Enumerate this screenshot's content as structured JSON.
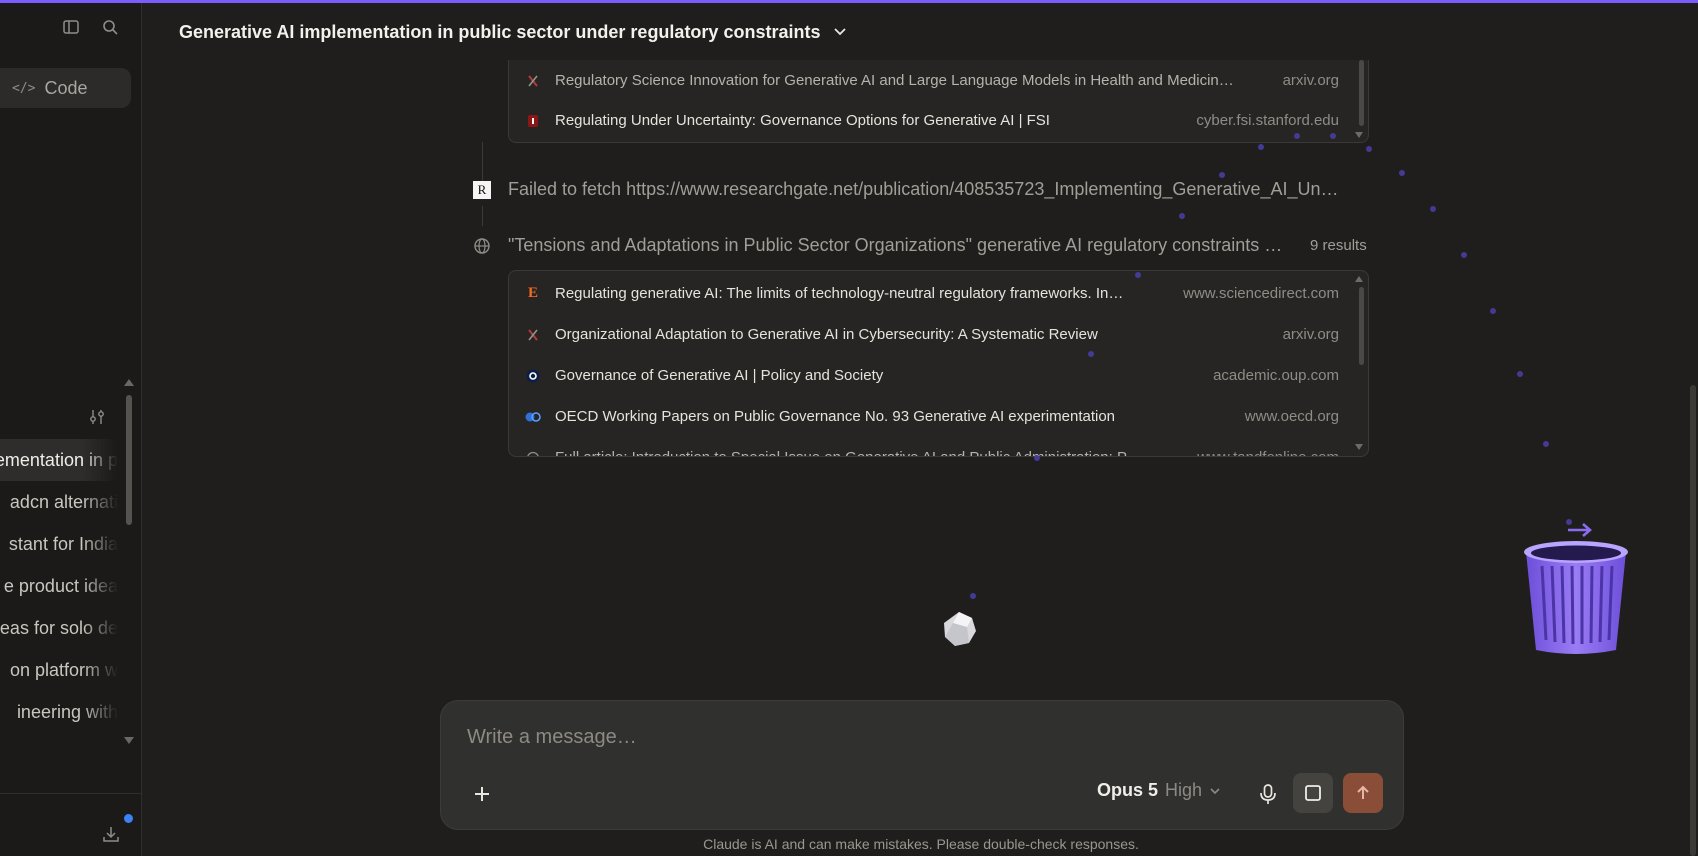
{
  "sidebar": {
    "code_label": "Code",
    "chats": [
      {
        "label": "ementation in p"
      },
      {
        "label": "adcn alternati"
      },
      {
        "label": "stant for India"
      },
      {
        "label": "e product idea"
      },
      {
        "label": "eas for solo de"
      },
      {
        "label": "on platform w"
      },
      {
        "label": "ineering with"
      }
    ]
  },
  "header": {
    "title": "Generative AI implementation in public sector under regulatory constraints"
  },
  "results_top": [
    {
      "title": "Regulatory Science Innovation for Generative AI and Large Language Models in Health and Medicin…",
      "domain": "arxiv.org",
      "favicon": "arxiv-icon"
    },
    {
      "title": "Regulating Under Uncertainty: Governance Options for Generative AI | FSI",
      "domain": "cyber.fsi.stanford.edu",
      "favicon": "stanford-icon"
    }
  ],
  "fetch_step": {
    "text": "Failed to fetch https://www.researchgate.net/publication/408535723_Implementing_Generative_AI_Un…",
    "icon_label": "R"
  },
  "search_step": {
    "query": "\"Tensions and Adaptations in Public Sector Organizations\" generative AI regulatory constraints …",
    "count": "9 results"
  },
  "results_bottom": [
    {
      "title": "Regulating generative AI: The limits of technology-neutral regulatory frameworks. In…",
      "domain": "www.sciencedirect.com",
      "favicon": "elsevier-icon",
      "glyph": "E"
    },
    {
      "title": "Organizational Adaptation to Generative AI in Cybersecurity: A Systematic Review",
      "domain": "arxiv.org",
      "favicon": "arxiv-icon"
    },
    {
      "title": "Governance of Generative AI | Policy and Society",
      "domain": "academic.oup.com",
      "favicon": "oup-icon"
    },
    {
      "title": "OECD Working Papers on Public Governance No. 93 Generative AI experimentation",
      "domain": "www.oecd.org",
      "favicon": "oecd-icon"
    },
    {
      "title": "Full article: Introduction to Special Issue on Generative AI and Public Administration: P…",
      "domain": "www.tandfonline.com",
      "favicon": "globe-icon"
    }
  ],
  "composer": {
    "placeholder": "Write a message…",
    "model": "Opus 5",
    "effort": "High"
  },
  "disclaimer": "Claude is AI and can make mistakes. Please double-check responses.",
  "colors": {
    "background": "#1f1e1d",
    "accent": "#7c5cff",
    "send_button": "#8a4d37",
    "trash": "#8b6cf0"
  }
}
